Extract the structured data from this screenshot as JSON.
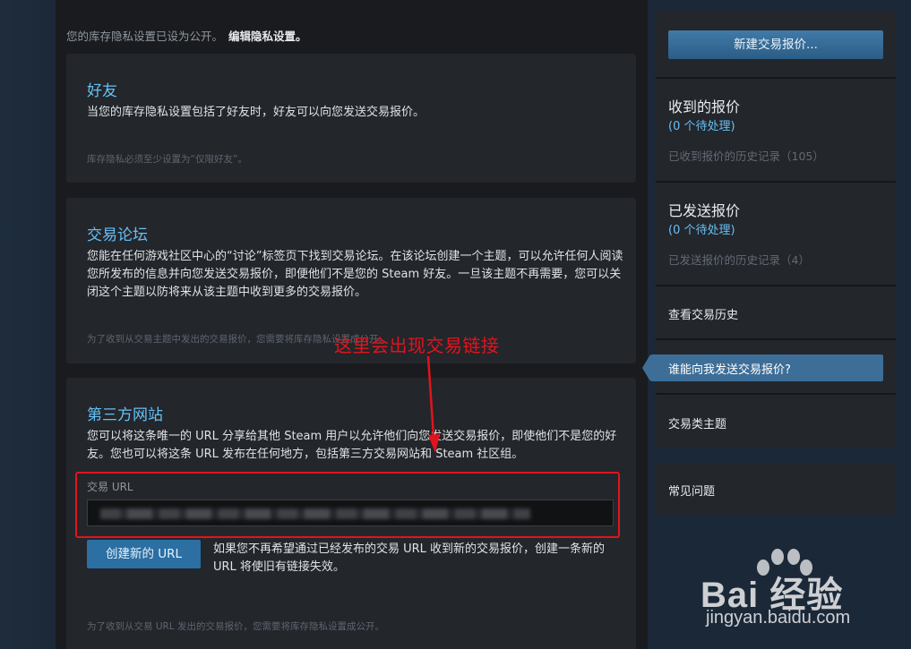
{
  "privacy_note": {
    "text": "您的库存隐私设置已设为公开。",
    "edit_link": "编辑隐私设置。"
  },
  "sections": {
    "friends": {
      "title": "好友",
      "desc": "当您的库存隐私设置包括了好友时，好友可以向您发送交易报价。",
      "footnote": "库存隐私必须至少设置为“仅限好友”。"
    },
    "forum": {
      "title": "交易论坛",
      "desc": "您能在任何游戏社区中心的“讨论”标签页下找到交易论坛。在该论坛创建一个主题，可以允许任何人阅读您所发布的信息并向您发送交易报价，即便他们不是您的 Steam 好友。一旦该主题不再需要，您可以关闭这个主题以防将来从该主题中收到更多的交易报价。",
      "footnote": "为了收到从交易主题中发出的交易报价，您需要将库存隐私设置成公开。"
    },
    "third_party": {
      "title": "第三方网站",
      "desc": "您可以将这条唯一的 URL 分享给其他 Steam 用户以允许他们向您发送交易报价，即使他们不是您的好友。您也可以将这条 URL 发布在任何地方，包括第三方交易网站和 Steam 社区组。",
      "url_label": "交易 URL",
      "create_button": "创建新的 URL",
      "create_desc": "如果您不再希望通过已经发布的交易 URL 收到新的交易报价，创建一条新的 URL 将使旧有链接失效。",
      "footnote": "为了收到从交易 URL 发出的交易报价，您需要将库存隐私设置成公开。"
    }
  },
  "annotation": "这里会出现交易链接",
  "sidebar": {
    "new_offer_button": "新建交易报价...",
    "received": {
      "title": "收到的报价",
      "pending": "(0 个待处理)",
      "history": "已收到报价的历史记录（105）"
    },
    "sent": {
      "title": "已发送报价",
      "pending": "(0 个待处理)",
      "history": "已发送报价的历史记录（4）"
    },
    "view_history": "查看交易历史",
    "who_can_send": "谁能向我发送交易报价?",
    "trade_topics": "交易类主题",
    "faq": "常见问题"
  },
  "watermark": {
    "logo": "Bai 经验",
    "url": "jingyan.baidu.com"
  },
  "colors": {
    "accent_blue": "#66c0f4",
    "annotation_red": "#e1141c",
    "button_blue": "#2b6fa3"
  }
}
